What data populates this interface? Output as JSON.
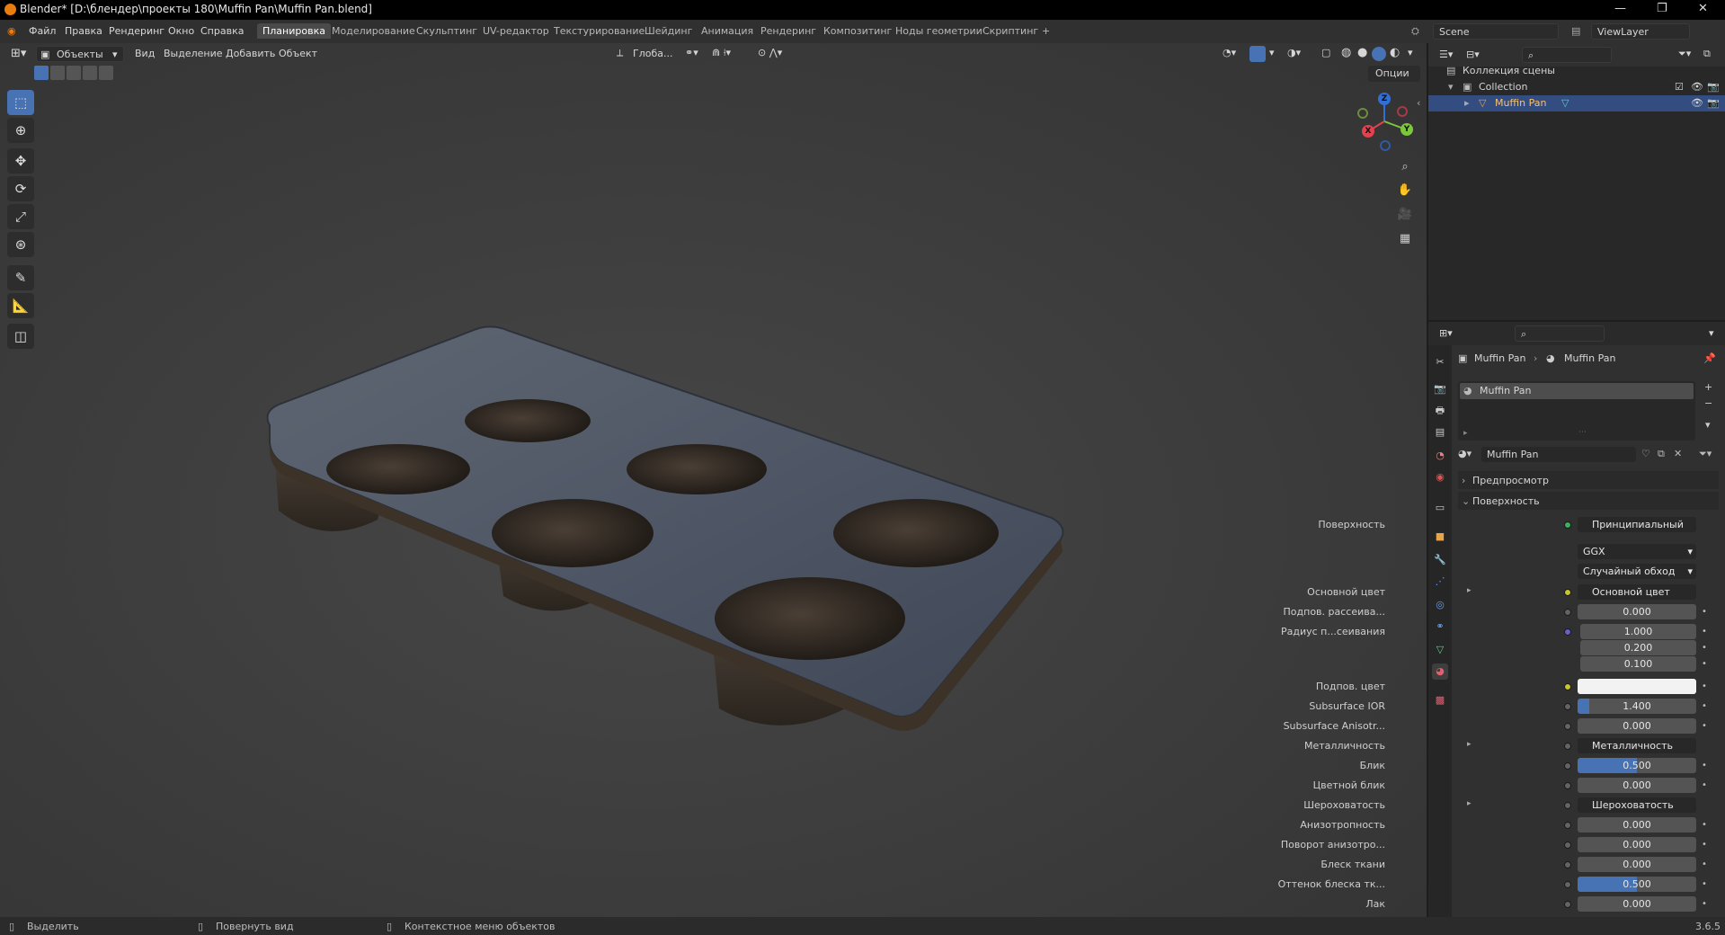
{
  "window": {
    "title": "Blender* [D:\\блендер\\проекты 180\\Muffin Pan\\Muffin Pan.blend]"
  },
  "topbar": {
    "menus": [
      "Файл",
      "Правка",
      "Рендеринг",
      "Окно",
      "Справка"
    ],
    "workspaces": [
      "Планировка",
      "Моделирование",
      "Скульптинг",
      "UV-редактор",
      "Текстурирование",
      "Шейдинг",
      "Анимация",
      "Рендеринг",
      "Композитинг",
      "Ноды геометрии",
      "Скриптинг"
    ],
    "active_workspace": "Планировка",
    "add_tab": "+",
    "scene": "Scene",
    "view_layer": "ViewLayer"
  },
  "viewport": {
    "mode": "Объекты",
    "menus": [
      "Вид",
      "Выделение",
      "Добавить",
      "Объект"
    ],
    "transform_orientation": "Глоба...",
    "options": "Опции",
    "gizmo": {
      "z": "Z",
      "y": "Y",
      "x": "X"
    }
  },
  "outliner": {
    "rows": [
      {
        "label": "Коллекция сцены"
      },
      {
        "label": "Collection"
      },
      {
        "label": "Muffin Pan"
      }
    ]
  },
  "properties": {
    "breadcrumb_object": "Muffin Pan",
    "breadcrumb_material": "Muffin Pan",
    "slot_name": "Muffin Pan",
    "material_name": "Muffin Pan",
    "panels": {
      "preview": "Предпросмотр",
      "surface": "Поверхность"
    },
    "surface_label": "Поверхность",
    "surface_value": "Принципиальный BSDF",
    "distribution": "GGX",
    "subsurface_method": "Случайный обход",
    "rows": [
      {
        "label": "Основной цвет",
        "value": "Основной цвет"
      },
      {
        "label": "Подпов. рассеива...",
        "value": "0.000"
      },
      {
        "label": "Радиус п...сеивания",
        "value": "1.000"
      },
      {
        "label": "",
        "value": "0.200"
      },
      {
        "label": "",
        "value": "0.100"
      },
      {
        "label": "Подпов. цвет",
        "value": ""
      },
      {
        "label": "Subsurface IOR",
        "value": "1.400"
      },
      {
        "label": "Subsurface Anisotr...",
        "value": "0.000"
      },
      {
        "label": "Металличность",
        "value": "Металличность"
      },
      {
        "label": "Блик",
        "value": "0.500"
      },
      {
        "label": "Цветной блик",
        "value": "0.000"
      },
      {
        "label": "Шероховатость",
        "value": "Шероховатость"
      },
      {
        "label": "Анизотропность",
        "value": "0.000"
      },
      {
        "label": "Поворот анизотро...",
        "value": "0.000"
      },
      {
        "label": "Блеск ткани",
        "value": "0.000"
      },
      {
        "label": "Оттенок блеска тк...",
        "value": "0.500"
      },
      {
        "label": "Лак",
        "value": "0.000"
      }
    ],
    "fills": {
      "subsurface_ior": 0.1,
      "specular": 0.5,
      "sheen_tint": 0.5
    }
  },
  "statusbar": {
    "select": "Выделить",
    "rotate": "Повернуть вид",
    "context": "Контекстное меню объектов",
    "version": "3.6.5"
  }
}
